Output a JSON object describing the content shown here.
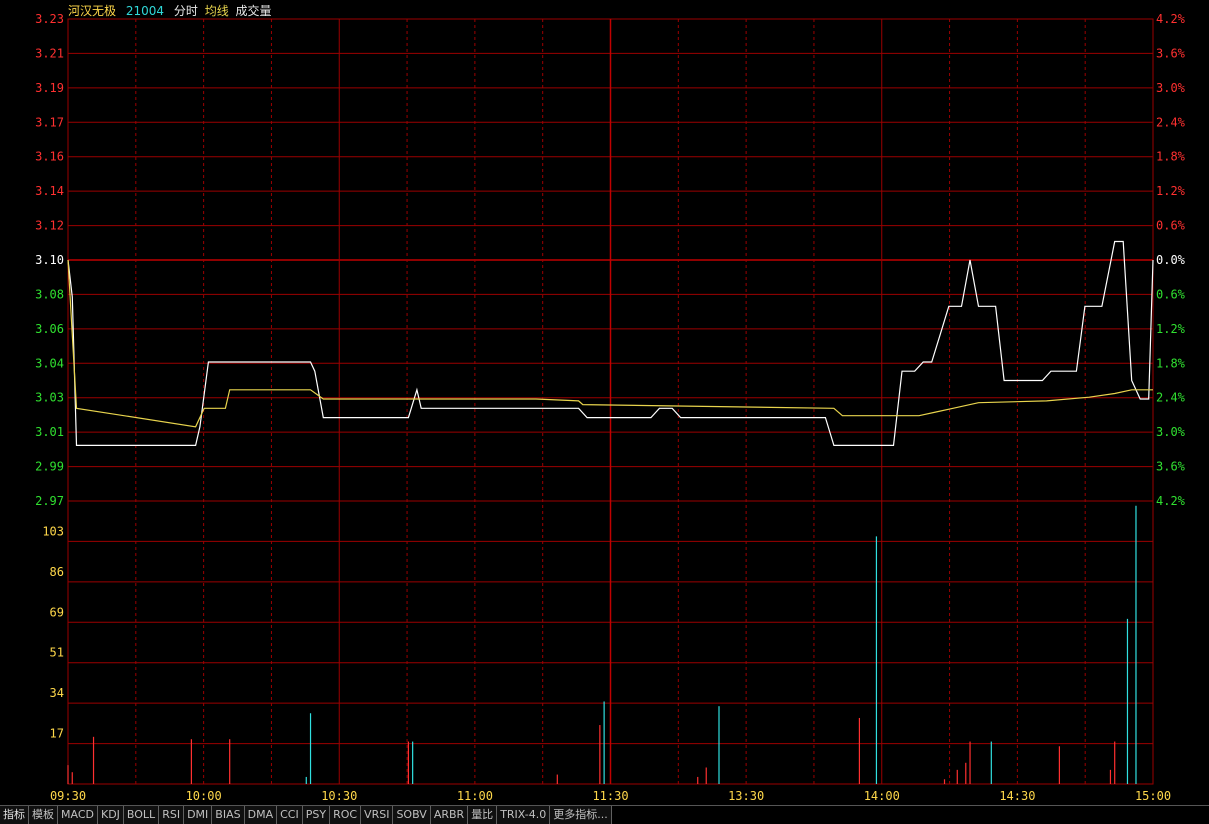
{
  "header": {
    "name": "河汉无极",
    "code": "21004",
    "labels": [
      "分时",
      "均线",
      "成交量"
    ]
  },
  "colors": {
    "grid": "#9b0000",
    "price_line": "#ffffff",
    "avg_line": "#e8d44d",
    "up_text": "#ff3030",
    "down_text": "#30e030",
    "base_text": "#ffffff",
    "vol_text": "#ffd84a",
    "time_text": "#ffd84a",
    "vol_up": "#ff3030",
    "vol_down": "#30e0e0"
  },
  "tabs": [
    "指标",
    "模板",
    "MACD",
    "KDJ",
    "BOLL",
    "RSI",
    "DMI",
    "BIAS",
    "DMA",
    "CCI",
    "PSY",
    "ROC",
    "VRSI",
    "SOBV",
    "ARBR",
    "量比",
    "TRIX-4.0",
    "更多指标..."
  ],
  "chart_data": {
    "type": "line",
    "base_price": 3.1,
    "price_axis": {
      "range": [
        2.97,
        3.23
      ],
      "ticks": [
        "3.23",
        "3.21",
        "3.19",
        "3.17",
        "3.16",
        "3.14",
        "3.12",
        "3.10",
        "3.08",
        "3.06",
        "3.04",
        "3.03",
        "3.01",
        "2.99",
        "2.97"
      ],
      "pct_ticks": [
        "4.2%",
        "3.6%",
        "3.0%",
        "2.4%",
        "1.8%",
        "1.2%",
        "0.6%",
        "0.0%",
        "0.6%",
        "1.2%",
        "1.8%",
        "2.4%",
        "3.0%",
        "3.6%",
        "4.2%"
      ]
    },
    "volume_axis": {
      "range": [
        0,
        120
      ],
      "ticks": [
        "103",
        "86",
        "69",
        "51",
        "34",
        "17"
      ]
    },
    "time_labels": [
      "09:30",
      "10:00",
      "10:30",
      "11:00",
      "11:30",
      "13:30",
      "14:00",
      "14:30",
      "15:00"
    ],
    "series": [
      {
        "name": "分时",
        "points": [
          [
            0,
            3.1
          ],
          [
            1,
            3.08
          ],
          [
            2,
            3.0
          ],
          [
            30,
            3.0
          ],
          [
            31,
            3.01
          ],
          [
            33,
            3.045
          ],
          [
            57,
            3.045
          ],
          [
            58,
            3.04
          ],
          [
            60,
            3.015
          ],
          [
            80,
            3.015
          ],
          [
            82,
            3.03
          ],
          [
            83,
            3.02
          ],
          [
            120,
            3.02
          ],
          [
            122,
            3.015
          ],
          [
            137,
            3.015
          ],
          [
            139,
            3.02
          ],
          [
            142,
            3.02
          ],
          [
            144,
            3.015
          ],
          [
            178,
            3.015
          ],
          [
            180,
            3.0
          ],
          [
            194,
            3.0
          ],
          [
            196,
            3.04
          ],
          [
            199,
            3.04
          ],
          [
            201,
            3.045
          ],
          [
            203,
            3.045
          ],
          [
            205,
            3.06
          ],
          [
            207,
            3.075
          ],
          [
            210,
            3.075
          ],
          [
            212,
            3.1
          ],
          [
            214,
            3.075
          ],
          [
            218,
            3.075
          ],
          [
            220,
            3.035
          ],
          [
            229,
            3.035
          ],
          [
            231,
            3.04
          ],
          [
            237,
            3.04
          ],
          [
            239,
            3.075
          ],
          [
            243,
            3.075
          ],
          [
            246,
            3.11
          ],
          [
            248,
            3.11
          ],
          [
            250,
            3.035
          ],
          [
            252,
            3.025
          ],
          [
            254,
            3.025
          ],
          [
            255,
            3.1
          ]
        ]
      },
      {
        "name": "均线",
        "points": [
          [
            0,
            3.1
          ],
          [
            2,
            3.02
          ],
          [
            30,
            3.01
          ],
          [
            32,
            3.02
          ],
          [
            37,
            3.02
          ],
          [
            38,
            3.03
          ],
          [
            55,
            3.03
          ],
          [
            57,
            3.03
          ],
          [
            60,
            3.025
          ],
          [
            110,
            3.025
          ],
          [
            120,
            3.024
          ],
          [
            121,
            3.022
          ],
          [
            180,
            3.02
          ],
          [
            182,
            3.016
          ],
          [
            200,
            3.016
          ],
          [
            204,
            3.018
          ],
          [
            208,
            3.02
          ],
          [
            214,
            3.023
          ],
          [
            230,
            3.024
          ],
          [
            240,
            3.026
          ],
          [
            246,
            3.028
          ],
          [
            250,
            3.03
          ],
          [
            255,
            3.03
          ]
        ]
      }
    ],
    "volume_bars": [
      [
        0,
        8,
        "up"
      ],
      [
        1,
        5,
        "up"
      ],
      [
        6,
        20,
        "up"
      ],
      [
        29,
        19,
        "up"
      ],
      [
        38,
        19,
        "up"
      ],
      [
        56,
        3,
        "down"
      ],
      [
        57,
        30,
        "down"
      ],
      [
        80,
        18,
        "up"
      ],
      [
        81,
        18,
        "down"
      ],
      [
        115,
        4,
        "up"
      ],
      [
        125,
        25,
        "up"
      ],
      [
        126,
        35,
        "down"
      ],
      [
        148,
        3,
        "up"
      ],
      [
        150,
        7,
        "up"
      ],
      [
        153,
        33,
        "down"
      ],
      [
        186,
        28,
        "up"
      ],
      [
        190,
        105,
        "down"
      ],
      [
        206,
        2,
        "up"
      ],
      [
        209,
        6,
        "up"
      ],
      [
        211,
        9,
        "up"
      ],
      [
        212,
        18,
        "up"
      ],
      [
        217,
        18,
        "down"
      ],
      [
        233,
        16,
        "up"
      ],
      [
        245,
        6,
        "up"
      ],
      [
        246,
        18,
        "up"
      ],
      [
        249,
        70,
        "down"
      ],
      [
        251,
        118,
        "down"
      ]
    ]
  }
}
